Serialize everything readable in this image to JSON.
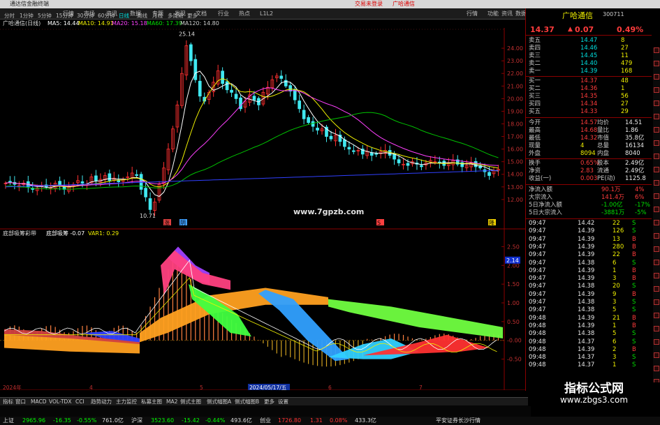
{
  "window": {
    "title": "通达信金融终端",
    "notice": "交易未登录",
    "stock_title": "广哈通信"
  },
  "menu": {
    "items": [
      "行情",
      "市场",
      "资讯",
      "数据",
      "专题",
      "发现",
      "文档",
      "行业",
      "热点",
      "L1L2"
    ],
    "right": [
      "功能",
      "资讯",
      "数据",
      "退出"
    ]
  },
  "periods": [
    "分时",
    "1分钟",
    "5分钟",
    "15分钟",
    "30分钟",
    "60分钟",
    "日线",
    "周线",
    "月线",
    "多周期",
    "更多"
  ],
  "info": {
    "name": "广哈通信(日线)",
    "ma5": "MA5: 14.44",
    "ma10": "MA10: 14.91",
    "ma20": "MA20: 15.18",
    "ma60": "MA60: 17.39",
    "ma120": "MA120: 14.80"
  },
  "ind_info": {
    "name": "底部吸筹彩带",
    "line1": "底部吸筹 -0.07",
    "line2": "VAR1: 0.29"
  },
  "chart_data": [
    {
      "type": "candlestick",
      "title": "",
      "ylim": [
        10,
        25.5
      ],
      "ticks": [
        "24.00",
        "23.00",
        "22.00",
        "21.00",
        "20.00",
        "19.00",
        "18.00",
        "17.00",
        "16.00",
        "15.00",
        "14.00",
        "13.00",
        "12.00"
      ],
      "labels": {
        "high": "25.14",
        "low": "10.71"
      },
      "markers": [
        "涨",
        "阴",
        "S",
        "降"
      ]
    },
    {
      "type": "ribbon",
      "title": "",
      "ylim": [
        -0.75,
        2.75
      ],
      "ticks": [
        "2.50",
        "2.00",
        "1.50",
        "1.00",
        "0.50",
        "-0.00",
        "-0.50"
      ],
      "current": "2.14"
    }
  ],
  "dates": {
    "d1": "2024年",
    "d2": "4",
    "d3": "5",
    "d4": "2024/05/17/五",
    "d5": "6",
    "d6": "7"
  },
  "quote": {
    "name": "广哈通信",
    "code": "300711",
    "price": "14.37",
    "change": "0.07",
    "pct": "0.49%"
  },
  "orderbook": [
    {
      "label": "卖五",
      "price": "14.47",
      "vol": "8",
      "cls": "dn"
    },
    {
      "label": "卖四",
      "price": "14.46",
      "vol": "27",
      "cls": "dn"
    },
    {
      "label": "卖三",
      "price": "14.45",
      "vol": "11",
      "cls": "dn"
    },
    {
      "label": "卖二",
      "price": "14.40",
      "vol": "479",
      "cls": "dn"
    },
    {
      "label": "卖一",
      "price": "14.39",
      "vol": "168",
      "cls": "dn"
    },
    {
      "label": "买一",
      "price": "14.37",
      "vol": "48",
      "cls": "up"
    },
    {
      "label": "买二",
      "price": "14.36",
      "vol": "1",
      "cls": "up"
    },
    {
      "label": "买三",
      "price": "14.35",
      "vol": "56",
      "cls": "up"
    },
    {
      "label": "买四",
      "price": "14.34",
      "vol": "27",
      "cls": "up"
    },
    {
      "label": "买五",
      "price": "14.33",
      "vol": "29",
      "cls": "up"
    }
  ],
  "stats": [
    {
      "l1": "今开",
      "v1": "14.57",
      "l2": "均价",
      "v2": "14.51"
    },
    {
      "l1": "最高",
      "v1": "14.68",
      "l2": "量比",
      "v2": "1.86"
    },
    {
      "l1": "最低",
      "v1": "14.32",
      "l2": "市值",
      "v2": "35.8亿"
    },
    {
      "l1": "现量",
      "v1": "4",
      "l2": "总量",
      "v2": "16134"
    },
    {
      "l1": "外盘",
      "v1": "8094",
      "l2": "内盘",
      "v2": "8040"
    },
    {
      "l1": "换手",
      "v1": "0.65%",
      "l2": "股本",
      "v2": "2.49亿"
    },
    {
      "l1": "净资",
      "v1": "2.83",
      "l2": "流通",
      "v2": "2.49亿"
    },
    {
      "l1": "收益(一)",
      "v1": "0.003",
      "l2": "PE(动)",
      "v2": "1125.8"
    }
  ],
  "flows": [
    {
      "label": "净流入额",
      "value": "90.1万",
      "pct": "4%"
    },
    {
      "label": "大宗流入",
      "value": "141.4万",
      "pct": "6%"
    },
    {
      "label": "5日净流入额",
      "value": "-1.00亿",
      "pct": "-17%"
    },
    {
      "label": "5日大宗流入",
      "value": "-3881万",
      "pct": "-5%"
    }
  ],
  "ticks": [
    {
      "t": "09:47",
      "p": "14.42",
      "v": "22",
      "s": "S"
    },
    {
      "t": "09:47",
      "p": "14.39",
      "v": "126",
      "s": "S"
    },
    {
      "t": "09:47",
      "p": "14.39",
      "v": "13",
      "s": "B"
    },
    {
      "t": "09:47",
      "p": "14.39",
      "v": "280",
      "s": "B"
    },
    {
      "t": "09:47",
      "p": "14.39",
      "v": "22",
      "s": "B"
    },
    {
      "t": "09:47",
      "p": "14.38",
      "v": "6",
      "s": "S"
    },
    {
      "t": "09:47",
      "p": "14.39",
      "v": "1",
      "s": "B"
    },
    {
      "t": "09:47",
      "p": "14.39",
      "v": "3",
      "s": "B"
    },
    {
      "t": "09:47",
      "p": "14.38",
      "v": "20",
      "s": "S"
    },
    {
      "t": "09:47",
      "p": "14.39",
      "v": "9",
      "s": "B"
    },
    {
      "t": "09:47",
      "p": "14.38",
      "v": "3",
      "s": "S"
    },
    {
      "t": "09:47",
      "p": "14.38",
      "v": "5",
      "s": "S"
    },
    {
      "t": "09:48",
      "p": "14.39",
      "v": "21",
      "s": "B"
    },
    {
      "t": "09:48",
      "p": "14.39",
      "v": "1",
      "s": "B"
    },
    {
      "t": "09:48",
      "p": "14.38",
      "v": "5",
      "s": "S"
    },
    {
      "t": "09:48",
      "p": "14.37",
      "v": "6",
      "s": "S"
    },
    {
      "t": "09:48",
      "p": "14.39",
      "v": "2",
      "s": "B"
    },
    {
      "t": "09:48",
      "p": "14.37",
      "v": "3",
      "s": "S"
    },
    {
      "t": "09:48",
      "p": "14.37",
      "v": "1",
      "s": "S"
    }
  ],
  "tabs": [
    "指标",
    "窗口",
    "MACD",
    "VOL-TDX",
    "CCI",
    "趋势动力",
    "主力监控",
    "私募主图",
    "MA2",
    "侧式主图",
    "侧式幅图A",
    "侧式幅图B",
    "更多",
    "设置"
  ],
  "status": {
    "sh_name": "上证",
    "sh_val": "2965.96",
    "sh_chg": "-16.35",
    "sh_pct": "-0.55%",
    "sh_amt": "761.0亿",
    "sz_name": "沪深",
    "sz_val": "3523.60",
    "sz_chg": "-15.42",
    "sz_pct": "-0.44%",
    "sz_amt": "493.6亿",
    "cy_name": "创业",
    "cy_val": "1726.80",
    "cy_chg": "1.31",
    "cy_pct": "0.08%",
    "cy_amt": "433.3亿",
    "broker": "平安证券长沙行情"
  },
  "watermark": {
    "main": "指标公式网",
    "sub": "www.zbgs3.com",
    "mid": "www.7gpzb.com"
  }
}
